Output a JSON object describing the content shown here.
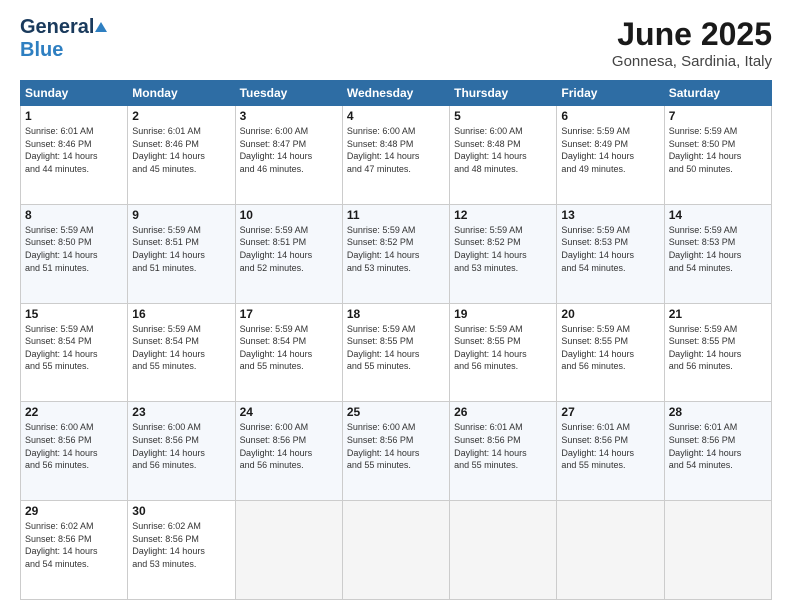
{
  "header": {
    "logo_general": "General",
    "logo_blue": "Blue",
    "main_title": "June 2025",
    "subtitle": "Gonnesa, Sardinia, Italy"
  },
  "calendar": {
    "headers": [
      "Sunday",
      "Monday",
      "Tuesday",
      "Wednesday",
      "Thursday",
      "Friday",
      "Saturday"
    ],
    "rows": [
      [
        {
          "day": "1",
          "info": "Sunrise: 6:01 AM\nSunset: 8:46 PM\nDaylight: 14 hours\nand 44 minutes."
        },
        {
          "day": "2",
          "info": "Sunrise: 6:01 AM\nSunset: 8:46 PM\nDaylight: 14 hours\nand 45 minutes."
        },
        {
          "day": "3",
          "info": "Sunrise: 6:00 AM\nSunset: 8:47 PM\nDaylight: 14 hours\nand 46 minutes."
        },
        {
          "day": "4",
          "info": "Sunrise: 6:00 AM\nSunset: 8:48 PM\nDaylight: 14 hours\nand 47 minutes."
        },
        {
          "day": "5",
          "info": "Sunrise: 6:00 AM\nSunset: 8:48 PM\nDaylight: 14 hours\nand 48 minutes."
        },
        {
          "day": "6",
          "info": "Sunrise: 5:59 AM\nSunset: 8:49 PM\nDaylight: 14 hours\nand 49 minutes."
        },
        {
          "day": "7",
          "info": "Sunrise: 5:59 AM\nSunset: 8:50 PM\nDaylight: 14 hours\nand 50 minutes."
        }
      ],
      [
        {
          "day": "8",
          "info": "Sunrise: 5:59 AM\nSunset: 8:50 PM\nDaylight: 14 hours\nand 51 minutes."
        },
        {
          "day": "9",
          "info": "Sunrise: 5:59 AM\nSunset: 8:51 PM\nDaylight: 14 hours\nand 51 minutes."
        },
        {
          "day": "10",
          "info": "Sunrise: 5:59 AM\nSunset: 8:51 PM\nDaylight: 14 hours\nand 52 minutes."
        },
        {
          "day": "11",
          "info": "Sunrise: 5:59 AM\nSunset: 8:52 PM\nDaylight: 14 hours\nand 53 minutes."
        },
        {
          "day": "12",
          "info": "Sunrise: 5:59 AM\nSunset: 8:52 PM\nDaylight: 14 hours\nand 53 minutes."
        },
        {
          "day": "13",
          "info": "Sunrise: 5:59 AM\nSunset: 8:53 PM\nDaylight: 14 hours\nand 54 minutes."
        },
        {
          "day": "14",
          "info": "Sunrise: 5:59 AM\nSunset: 8:53 PM\nDaylight: 14 hours\nand 54 minutes."
        }
      ],
      [
        {
          "day": "15",
          "info": "Sunrise: 5:59 AM\nSunset: 8:54 PM\nDaylight: 14 hours\nand 55 minutes."
        },
        {
          "day": "16",
          "info": "Sunrise: 5:59 AM\nSunset: 8:54 PM\nDaylight: 14 hours\nand 55 minutes."
        },
        {
          "day": "17",
          "info": "Sunrise: 5:59 AM\nSunset: 8:54 PM\nDaylight: 14 hours\nand 55 minutes."
        },
        {
          "day": "18",
          "info": "Sunrise: 5:59 AM\nSunset: 8:55 PM\nDaylight: 14 hours\nand 55 minutes."
        },
        {
          "day": "19",
          "info": "Sunrise: 5:59 AM\nSunset: 8:55 PM\nDaylight: 14 hours\nand 56 minutes."
        },
        {
          "day": "20",
          "info": "Sunrise: 5:59 AM\nSunset: 8:55 PM\nDaylight: 14 hours\nand 56 minutes."
        },
        {
          "day": "21",
          "info": "Sunrise: 5:59 AM\nSunset: 8:55 PM\nDaylight: 14 hours\nand 56 minutes."
        }
      ],
      [
        {
          "day": "22",
          "info": "Sunrise: 6:00 AM\nSunset: 8:56 PM\nDaylight: 14 hours\nand 56 minutes."
        },
        {
          "day": "23",
          "info": "Sunrise: 6:00 AM\nSunset: 8:56 PM\nDaylight: 14 hours\nand 56 minutes."
        },
        {
          "day": "24",
          "info": "Sunrise: 6:00 AM\nSunset: 8:56 PM\nDaylight: 14 hours\nand 56 minutes."
        },
        {
          "day": "25",
          "info": "Sunrise: 6:00 AM\nSunset: 8:56 PM\nDaylight: 14 hours\nand 55 minutes."
        },
        {
          "day": "26",
          "info": "Sunrise: 6:01 AM\nSunset: 8:56 PM\nDaylight: 14 hours\nand 55 minutes."
        },
        {
          "day": "27",
          "info": "Sunrise: 6:01 AM\nSunset: 8:56 PM\nDaylight: 14 hours\nand 55 minutes."
        },
        {
          "day": "28",
          "info": "Sunrise: 6:01 AM\nSunset: 8:56 PM\nDaylight: 14 hours\nand 54 minutes."
        }
      ],
      [
        {
          "day": "29",
          "info": "Sunrise: 6:02 AM\nSunset: 8:56 PM\nDaylight: 14 hours\nand 54 minutes."
        },
        {
          "day": "30",
          "info": "Sunrise: 6:02 AM\nSunset: 8:56 PM\nDaylight: 14 hours\nand 53 minutes."
        },
        {
          "day": "",
          "info": ""
        },
        {
          "day": "",
          "info": ""
        },
        {
          "day": "",
          "info": ""
        },
        {
          "day": "",
          "info": ""
        },
        {
          "day": "",
          "info": ""
        }
      ]
    ]
  }
}
